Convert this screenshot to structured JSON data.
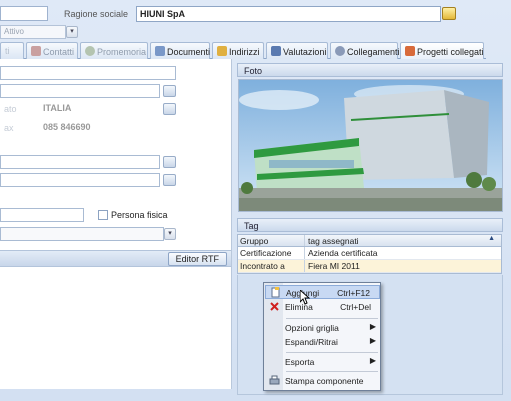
{
  "top": {
    "ragione_label": "Ragione sociale",
    "ragione_value": "HIUNI SpA",
    "status_value": "Attivo"
  },
  "tabs": [
    {
      "label": "Contatti",
      "dim": true,
      "icon": "contacts-icon",
      "color": "#c9a0a0"
    },
    {
      "label": "Promemoria",
      "dim": true,
      "icon": "clock-icon",
      "color": "#b4c4b0"
    },
    {
      "label": "Documenti",
      "dim": false,
      "icon": "document-icon",
      "color": "#7a98c8"
    },
    {
      "label": "Indirizzi",
      "dim": false,
      "icon": "address-icon",
      "color": "#e0b040"
    },
    {
      "label": "Valutazioni",
      "dim": false,
      "icon": "checklist-icon",
      "color": "#5a7ab0"
    },
    {
      "label": "Collegamenti",
      "dim": false,
      "icon": "link-icon",
      "color": "#8a9ab8"
    },
    {
      "label": "Progetti collegati",
      "dim": false,
      "icon": "projects-icon",
      "color": "#d86a3a"
    }
  ],
  "left": {
    "paese_label": "ato",
    "paese_value": "ITALIA",
    "tel_label": "ax",
    "tel_value": "085 846690",
    "persona_fisica_label": "Persona fisica",
    "editor_rtf": "Editor RTF"
  },
  "right": {
    "foto_label": "Foto",
    "tag_label": "Tag",
    "grid_headers": [
      "Gruppo",
      "tag assegnati"
    ],
    "grid_rows": [
      [
        "Certificazione",
        "Azienda certificata"
      ],
      [
        "Incontrato a",
        "Fiera MI 2011"
      ]
    ]
  },
  "menu": {
    "add": "Aggiungi",
    "add_shortcut": "Ctrl+F12",
    "delete": "Elimina",
    "delete_shortcut": "Ctrl+Del",
    "grid_options": "Opzioni griglia",
    "expand": "Espandi/Ritrai",
    "export": "Esporta",
    "print": "Stampa componente"
  },
  "colors": {
    "accent": "#8da6c8",
    "selection": "#fcf3d9",
    "menu_highlight": "#c8d9f3"
  }
}
